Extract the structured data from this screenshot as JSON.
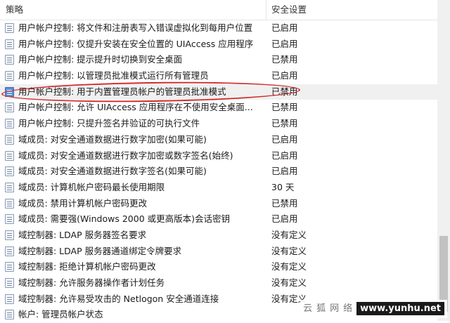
{
  "header": {
    "policy_label": "策略",
    "setting_label": "安全设置"
  },
  "rows": [
    {
      "name": "用户帐户控制: 将文件和注册表写入错误虚拟化到每用户位置",
      "value": "已启用"
    },
    {
      "name": "用户帐户控制: 仅提升安装在安全位置的 UIAccess 应用程序",
      "value": "已启用"
    },
    {
      "name": "用户帐户控制: 提示提升时切换到安全桌面",
      "value": "已禁用"
    },
    {
      "name": "用户帐户控制: 以管理员批准模式运行所有管理员",
      "value": "已启用"
    },
    {
      "name": "用户帐户控制: 用于内置管理员帐户的管理员批准模式",
      "value": "已禁用"
    },
    {
      "name": "用户帐户控制: 允许 UIAccess 应用程序在不使用安全桌面...",
      "value": "已禁用"
    },
    {
      "name": "用户帐户控制: 只提升签名并验证的可执行文件",
      "value": "已禁用"
    },
    {
      "name": "域成员: 对安全通道数据进行数字加密(如果可能)",
      "value": "已启用"
    },
    {
      "name": "域成员: 对安全通道数据进行数字加密或数字签名(始终)",
      "value": "已启用"
    },
    {
      "name": "域成员: 对安全通道数据进行数字签名(如果可能)",
      "value": "已启用"
    },
    {
      "name": "域成员: 计算机帐户密码最长使用期限",
      "value": "30 天"
    },
    {
      "name": "域成员: 禁用计算机帐户密码更改",
      "value": "已禁用"
    },
    {
      "name": "域成员: 需要强(Windows 2000 或更高版本)会话密钥",
      "value": "已启用"
    },
    {
      "name": "域控制器: LDAP 服务器签名要求",
      "value": "没有定义"
    },
    {
      "name": "域控制器: LDAP 服务器通道绑定令牌要求",
      "value": "没有定义"
    },
    {
      "name": "域控制器: 拒绝计算机帐户密码更改",
      "value": "没有定义"
    },
    {
      "name": "域控制器: 允许服务器操作者计划任务",
      "value": "没有定义"
    },
    {
      "name": "域控制器: 允许易受攻击的 Netlogon 安全通道连接",
      "value": "没有定义"
    },
    {
      "name": "帐户: 管理员帐户状态",
      "value": ""
    }
  ],
  "selected_index": 4,
  "icons": {
    "row_icon": "policy-icon"
  },
  "colors": {
    "annotation": "#d42a2a",
    "selected_row": "#f0f0f0"
  },
  "watermark": {
    "cn_text": "云狐网络",
    "url": "www.yunhu.net"
  }
}
